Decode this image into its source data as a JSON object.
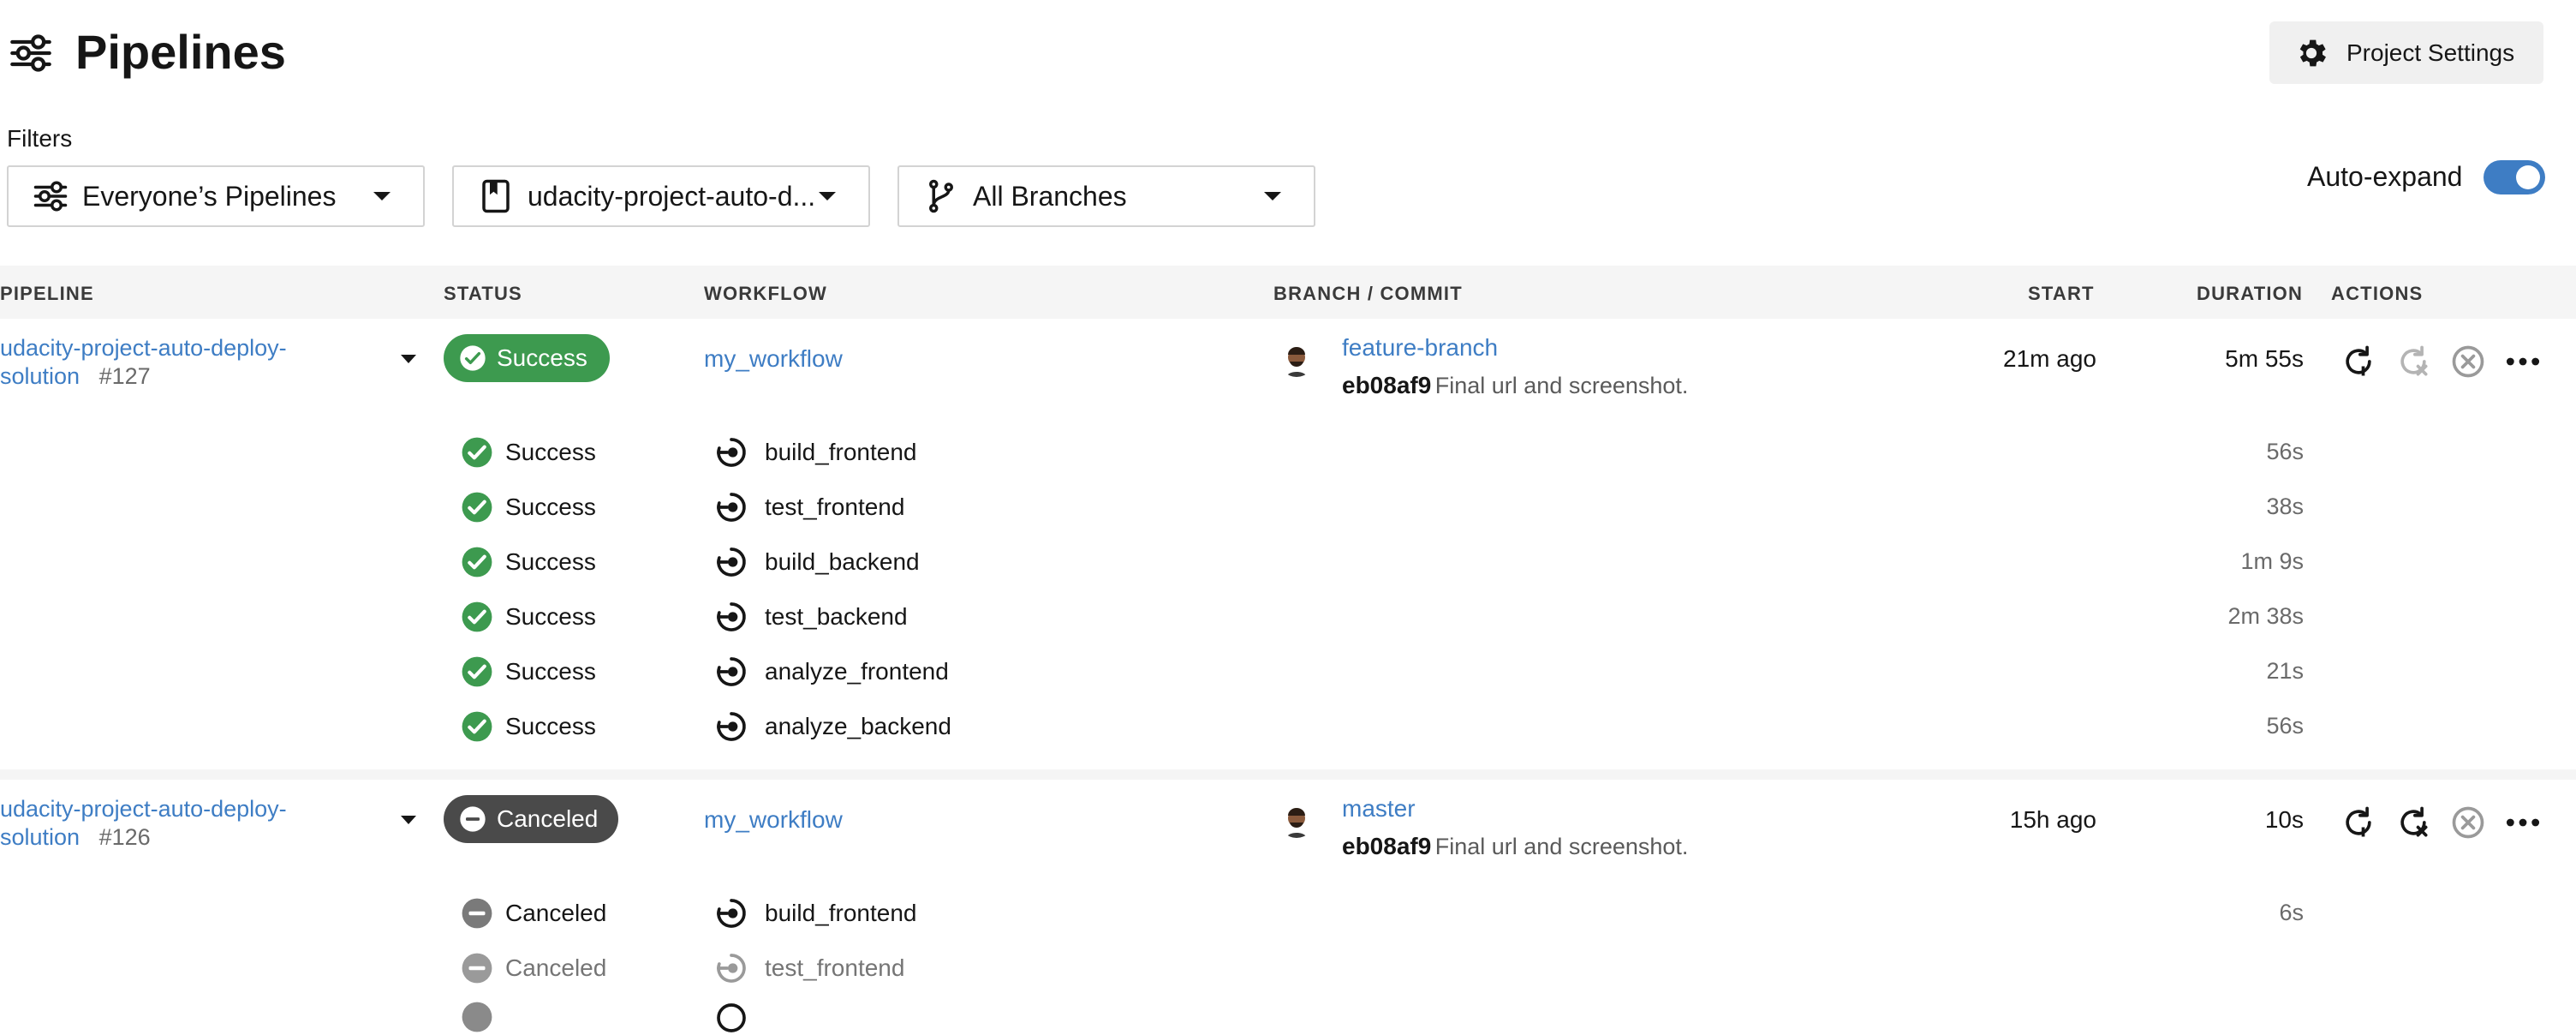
{
  "header": {
    "title": "Pipelines",
    "settings_label": "Project Settings"
  },
  "filters": {
    "label": "Filters",
    "owner": "Everyone’s Pipelines",
    "project": "udacity-project-auto-d...",
    "branch": "All Branches",
    "auto_expand_label": "Auto-expand",
    "auto_expand_on": true
  },
  "columns": [
    "PIPELINE",
    "STATUS",
    "WORKFLOW",
    "BRANCH / COMMIT",
    "START",
    "DURATION",
    "ACTIONS"
  ],
  "pipelines": [
    {
      "name_line1": "udacity-project-auto-deploy-",
      "name_line2": "solution",
      "number": "#127",
      "status": "Success",
      "workflow": "my_workflow",
      "branch": "feature-branch",
      "commit_hash": "eb08af9",
      "commit_message": "Final url and screenshot.",
      "start": "21m ago",
      "duration": "5m 55s",
      "jobs": [
        {
          "status": "Success",
          "name": "build_frontend",
          "duration": "56s"
        },
        {
          "status": "Success",
          "name": "test_frontend",
          "duration": "38s"
        },
        {
          "status": "Success",
          "name": "build_backend",
          "duration": "1m 9s"
        },
        {
          "status": "Success",
          "name": "test_backend",
          "duration": "2m 38s"
        },
        {
          "status": "Success",
          "name": "analyze_frontend",
          "duration": "21s"
        },
        {
          "status": "Success",
          "name": "analyze_backend",
          "duration": "56s"
        }
      ]
    },
    {
      "name_line1": "udacity-project-auto-deploy-",
      "name_line2": "solution",
      "number": "#126",
      "status": "Canceled",
      "workflow": "my_workflow",
      "branch": "master",
      "commit_hash": "eb08af9",
      "commit_message": "Final url and screenshot.",
      "start": "15h ago",
      "duration": "10s",
      "jobs": [
        {
          "status": "Canceled",
          "name": "build_frontend",
          "duration": "6s"
        },
        {
          "status": "Canceled",
          "name": "test_frontend",
          "duration": ""
        }
      ]
    }
  ],
  "colors": {
    "success": "#3d9a4f",
    "canceled": "#4a4a4a",
    "link": "#3e7dc4",
    "toggle": "#3e7dc4"
  }
}
